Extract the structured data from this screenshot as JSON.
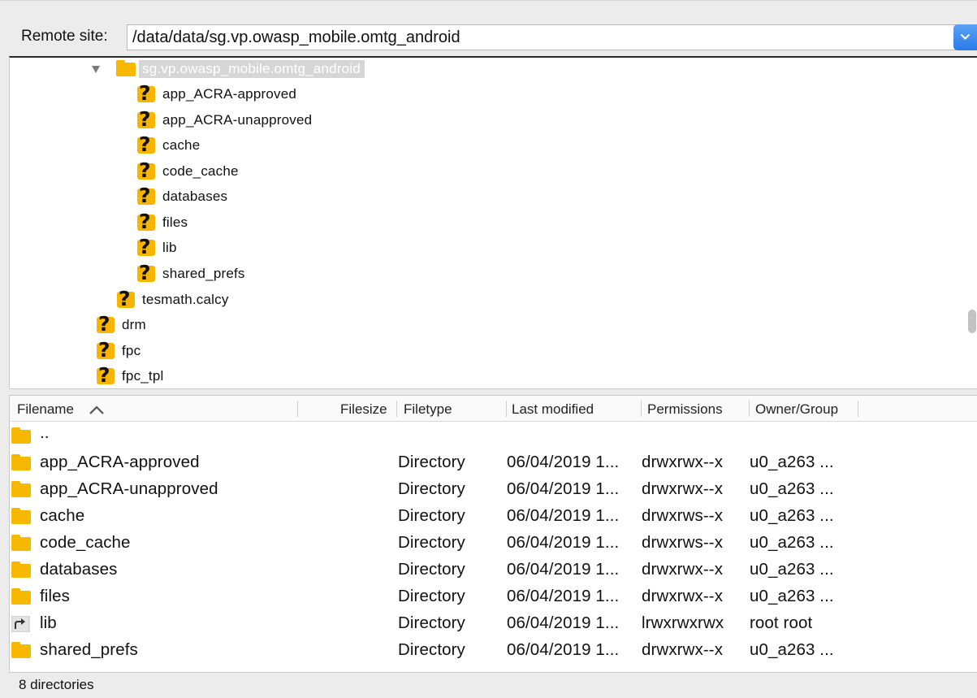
{
  "remote_site": {
    "label": "Remote site:",
    "path": "/data/data/sg.vp.owasp_mobile.omtg_android"
  },
  "tree": {
    "selected": "sg.vp.owasp_mobile.omtg_android",
    "children": [
      "app_ACRA-approved",
      "app_ACRA-unapproved",
      "cache",
      "code_cache",
      "databases",
      "files",
      "lib",
      "shared_prefs"
    ],
    "siblings": [
      "tesmath.calcy"
    ],
    "top_level": [
      "drm",
      "fpc",
      "fpc_tpl"
    ]
  },
  "columns": {
    "filename": "Filename",
    "filesize": "Filesize",
    "filetype": "Filetype",
    "last_modified": "Last modified",
    "permissions": "Permissions",
    "owner_group": "Owner/Group"
  },
  "files": [
    {
      "name": "..",
      "type": "",
      "modified": "",
      "perms": "",
      "owner": "",
      "icon": "folder-icon"
    },
    {
      "name": "app_ACRA-approved",
      "type": "Directory",
      "modified": "06/04/2019 1...",
      "perms": "drwxrwx--x",
      "owner": "u0_a263 ...",
      "icon": "folder-icon"
    },
    {
      "name": "app_ACRA-unapproved",
      "type": "Directory",
      "modified": "06/04/2019 1...",
      "perms": "drwxrwx--x",
      "owner": "u0_a263 ...",
      "icon": "folder-icon"
    },
    {
      "name": "cache",
      "type": "Directory",
      "modified": "06/04/2019 1...",
      "perms": "drwxrws--x",
      "owner": "u0_a263 ...",
      "icon": "folder-icon"
    },
    {
      "name": "code_cache",
      "type": "Directory",
      "modified": "06/04/2019 1...",
      "perms": "drwxrws--x",
      "owner": "u0_a263 ...",
      "icon": "folder-icon"
    },
    {
      "name": "databases",
      "type": "Directory",
      "modified": "06/04/2019 1...",
      "perms": "drwxrwx--x",
      "owner": "u0_a263 ...",
      "icon": "folder-icon"
    },
    {
      "name": "files",
      "type": "Directory",
      "modified": "06/04/2019 1...",
      "perms": "drwxrwx--x",
      "owner": "u0_a263 ...",
      "icon": "folder-icon"
    },
    {
      "name": "lib",
      "type": "Directory",
      "modified": "06/04/2019 1...",
      "perms": "lrwxrwxrwx",
      "owner": "root root",
      "icon": "symlink-icon"
    },
    {
      "name": "shared_prefs",
      "type": "Directory",
      "modified": "06/04/2019 1...",
      "perms": "drwxrwx--x",
      "owner": "u0_a263 ...",
      "icon": "folder-icon"
    }
  ],
  "status": "8 directories",
  "colors": {
    "folder": "#f8b800",
    "unknown_folder": "#f7b500",
    "combo_accent": "#2a7be9"
  }
}
